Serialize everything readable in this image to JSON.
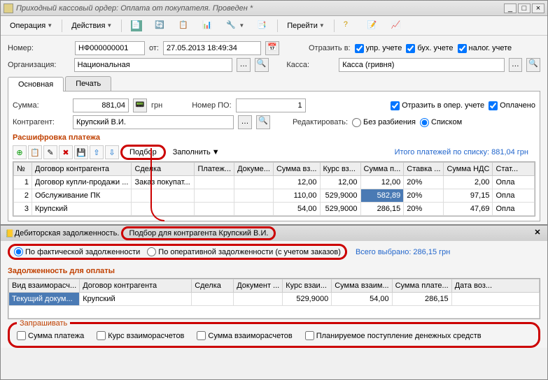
{
  "window": {
    "title": "Приходный кассовый ордер: Оплата от покупателя. Проведен *"
  },
  "toolbar": {
    "operation": "Операция",
    "actions": "Действия",
    "go": "Перейти"
  },
  "form": {
    "number_lbl": "Номер:",
    "number": "НФ000000001",
    "from_lbl": "от:",
    "date": "27.05.2013 18:49:34",
    "reflect_lbl": "Отразить в:",
    "upr": "упр. учете",
    "buh": "бух. учете",
    "nal": "налог. учете",
    "org_lbl": "Организация:",
    "org": "Национальная",
    "kassa_lbl": "Касса:",
    "kassa": "Касса (гривня)"
  },
  "tabs": {
    "main": "Основная",
    "print": "Печать"
  },
  "main": {
    "sum_lbl": "Сумма:",
    "sum": "881,04",
    "cur": "грн",
    "po_lbl": "Номер ПО:",
    "po": "1",
    "oper_reflect": "Отразить в опер. учете",
    "paid": "Оплачено",
    "ka_lbl": "Контрагент:",
    "ka": "Крупский В.И.",
    "edit_lbl": "Редактировать:",
    "r1": "Без разбиения",
    "r2": "Списком",
    "section": "Расшифровка платежа",
    "podbor": "Подбор",
    "fill": "Заполнить",
    "summary": "Итого платежей по списку: 881,04 грн",
    "cols": {
      "n": "№",
      "c1": "Договор контрагента",
      "c2": "Сделка",
      "c3": "Платеж...",
      "c4": "Докуме...",
      "c5": "Сумма вз...",
      "c6": "Курс вз...",
      "c7": "Сумма п...",
      "c8": "Ставка ...",
      "c9": "Сумма НДС",
      "c10": "Стат..."
    },
    "rows": [
      {
        "n": "1",
        "c1": "Договор купли-продажи ...",
        "c2": "Заказ покупат...",
        "c5": "12,00",
        "c6": "12,00",
        "c7": "12,00",
        "c8": "20%",
        "c9": "2,00",
        "c10": "Опла"
      },
      {
        "n": "2",
        "c1": "Обслуживание ПК",
        "c2": "",
        "c5": "110,00",
        "c6": "529,9000",
        "c7": "582,89",
        "c8": "20%",
        "c9": "97,15",
        "c10": "Опла"
      },
      {
        "n": "3",
        "c1": "Крупский",
        "c2": "",
        "c5": "54,00",
        "c6": "529,9000",
        "c7": "286,15",
        "c8": "20%",
        "c9": "47,69",
        "c10": "Опла"
      }
    ]
  },
  "sub": {
    "title_a": "Дебиторская задолженность.",
    "title_b": "Подбор для контрагента Крупский В.И.",
    "r1": "По фактической задолженности",
    "r2": "По оперативной задолженности (с учетом заказов)",
    "selected": "Всего выбрано: 286,15 грн",
    "section": "Задолженность для оплаты",
    "cols": {
      "c1": "Вид взаиморасч...",
      "c2": "Договор контрагента",
      "c3": "Сделка",
      "c4": "Документ ...",
      "c5": "Курс взаи...",
      "c6": "Сумма взаим...",
      "c7": "Сумма плате...",
      "c8": "Дата воз..."
    },
    "row": {
      "c1": "Текущий докум...",
      "c2": "Крупский",
      "c5": "529,9000",
      "c6": "54,00",
      "c7": "286,15"
    },
    "legend": "Запрашивать",
    "o1": "Сумма платежа",
    "o2": "Курс взаиморасчетов",
    "o3": "Сумма взаиморасчетов",
    "o4": "Планируемое поступление денежных средств"
  }
}
